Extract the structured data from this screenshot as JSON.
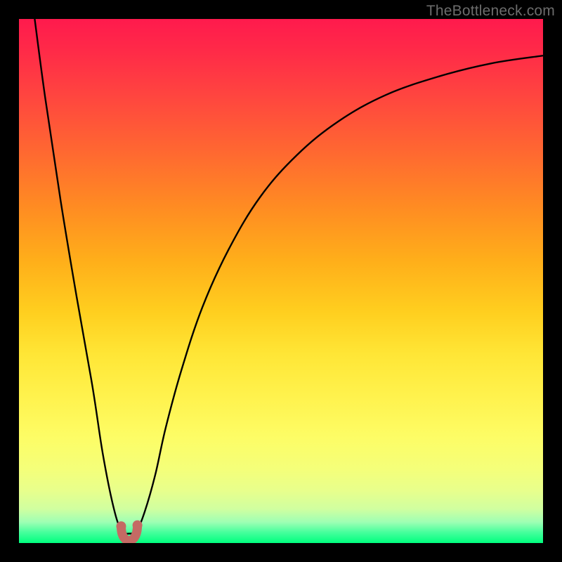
{
  "watermark": "TheBottleneck.com",
  "colors": {
    "frame": "#000000",
    "curve": "#000000",
    "valley_marker": "#c46a64",
    "gradient_top": "#ff1a4d",
    "gradient_bottom": "#00ff7e"
  },
  "chart_data": {
    "type": "line",
    "title": "",
    "xlabel": "",
    "ylabel": "",
    "xlim": [
      0,
      100
    ],
    "ylim": [
      0,
      100
    ],
    "series": [
      {
        "name": "bottleneck-curve",
        "x": [
          3,
          5,
          8,
          11,
          14,
          16,
          18,
          19.5,
          21,
          22.5,
          24,
          26,
          28,
          31,
          35,
          40,
          46,
          53,
          61,
          70,
          80,
          90,
          100
        ],
        "values": [
          100,
          85,
          65,
          47,
          30,
          17,
          7,
          2.5,
          1.8,
          2.5,
          6,
          13,
          22,
          33,
          45,
          56,
          66,
          74,
          80.5,
          85.5,
          89,
          91.5,
          93
        ]
      }
    ],
    "annotations": {
      "optimal_x": 21,
      "optimal_y": 1.8,
      "marker_points_x": [
        19.5,
        22.6
      ],
      "marker_points_y": [
        3.2,
        3.4
      ]
    }
  }
}
